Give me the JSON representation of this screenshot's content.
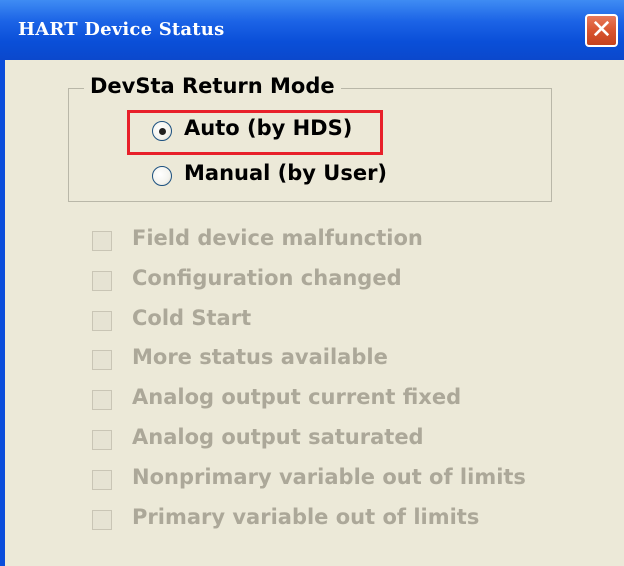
{
  "window": {
    "title": "HART Device Status",
    "close_symbol": "✕"
  },
  "mode_group": {
    "label": "DevSta Return Mode",
    "options": [
      {
        "label": "Auto (by HDS)",
        "selected": true
      },
      {
        "label": "Manual (by User)",
        "selected": false
      }
    ]
  },
  "status_flags": [
    {
      "label": "Field device malfunction",
      "checked": false,
      "enabled": false
    },
    {
      "label": "Configuration changed",
      "checked": false,
      "enabled": false
    },
    {
      "label": "Cold Start",
      "checked": false,
      "enabled": false
    },
    {
      "label": "More status available",
      "checked": false,
      "enabled": false
    },
    {
      "label": "Analog output current fixed",
      "checked": false,
      "enabled": false
    },
    {
      "label": "Analog output saturated",
      "checked": false,
      "enabled": false
    },
    {
      "label": "Nonprimary variable out of limits",
      "checked": false,
      "enabled": false
    },
    {
      "label": "Primary variable out of limits",
      "checked": false,
      "enabled": false
    }
  ],
  "colors": {
    "title_bar": "#0a4fd8",
    "dialog_bg": "#ece9d8",
    "disabled_text": "#aca899",
    "highlight": "#e8202a",
    "close_button": "#d9542f"
  }
}
